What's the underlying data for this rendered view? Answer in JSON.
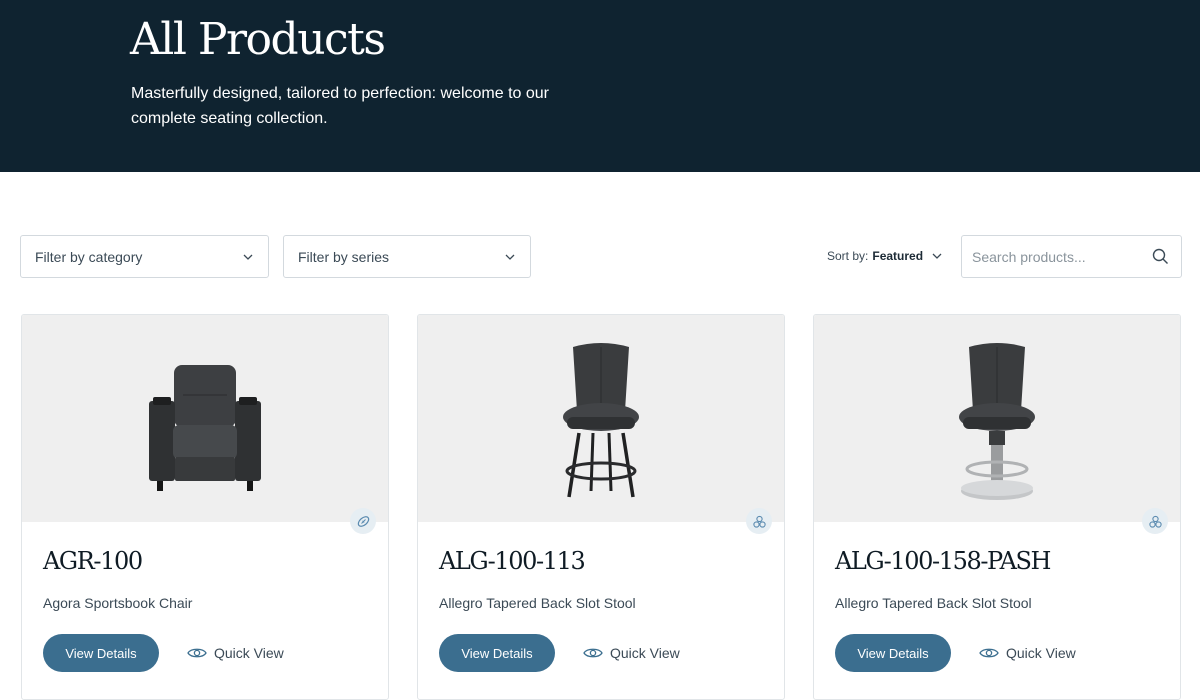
{
  "hero": {
    "title": "All Products",
    "subtitle": "Masterfully designed, tailored to perfection: welcome to our complete seating collection."
  },
  "filters": {
    "category_placeholder": "Filter by category",
    "series_placeholder": "Filter by series",
    "sort_label": "Sort by:",
    "sort_value": "Featured",
    "search_placeholder": "Search products..."
  },
  "products": [
    {
      "sku": "AGR-100",
      "name": "Agora Sportsbook Chair",
      "view_label": "View Details",
      "quick_label": "Quick View",
      "badge_icon": "football-icon"
    },
    {
      "sku": "ALG-100-113",
      "name": "Allegro Tapered Back Slot Stool",
      "view_label": "View Details",
      "quick_label": "Quick View",
      "badge_icon": "cherries-icon"
    },
    {
      "sku": "ALG-100-158-PASH",
      "name": "Allegro Tapered Back Slot Stool",
      "view_label": "View Details",
      "quick_label": "Quick View",
      "badge_icon": "cherries-icon"
    }
  ],
  "colors": {
    "hero_bg": "#0f2330",
    "button_bg": "#3b6e8f",
    "card_media_bg": "#efefef"
  }
}
